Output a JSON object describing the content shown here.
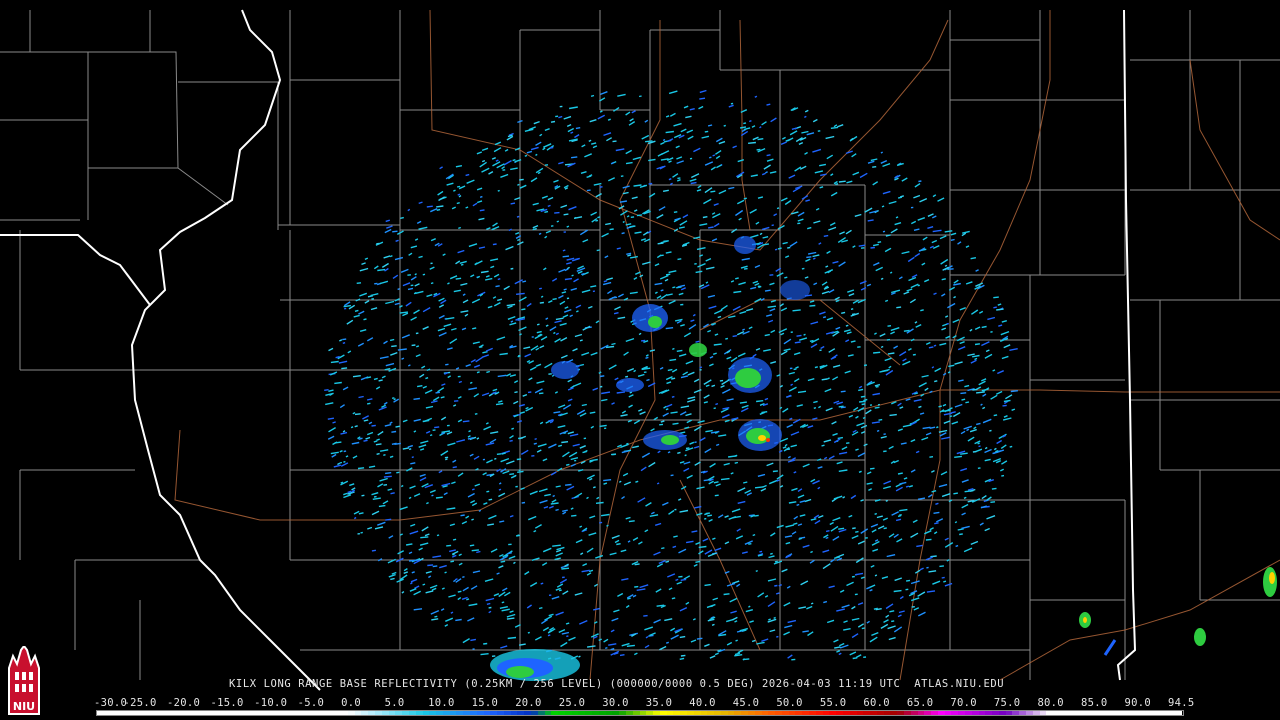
{
  "product": {
    "caption": "KILX LONG RANGE BASE REFLECTIVITY (0.25KM / 256 LEVEL) (000000/0000 0.5 DEG) 2026-04-03 11:19 UTC  ATLAS.NIU.EDU"
  },
  "colorbar": {
    "ticks": [
      "-30.0",
      "-25.0",
      "-20.0",
      "-15.0",
      "-10.0",
      "-5.0",
      "0.0",
      "5.0",
      "10.0",
      "15.0",
      "20.0",
      "25.0",
      "30.0",
      "35.0",
      "40.0",
      "45.0",
      "50.0",
      "55.0",
      "60.0",
      "65.0",
      "70.0",
      "75.0",
      "80.0",
      "85.0",
      "90.0",
      "94.5"
    ],
    "colors": [
      "#ffffff",
      "#ffffff",
      "#ffffff",
      "#ffffff",
      "#ffffff",
      "#ffffff",
      "#9ff",
      "#19c8e6",
      "#1e90ff",
      "#0050dc",
      "#00d200",
      "#00a000",
      "#007800",
      "#ffff00",
      "#e6b400",
      "#ff8c00",
      "#ff0000",
      "#c80000",
      "#960000",
      "#ff00ff",
      "#9900cc",
      "#ffffff",
      "#ffffff",
      "#ffffff",
      "#ffffff",
      "#ffffff"
    ]
  },
  "logo": {
    "text": "NIU"
  },
  "map": {
    "radar_site": "KILX",
    "colors": {
      "county_lines": "#8a8a8a",
      "state_lines": "#ffffff",
      "roads": "#b0653a",
      "light_echo": "#19c8e6",
      "moderate_echo": "#1e64ff",
      "heavy_echo": "#2ecc40",
      "intense_echo": "#ffd000"
    }
  }
}
